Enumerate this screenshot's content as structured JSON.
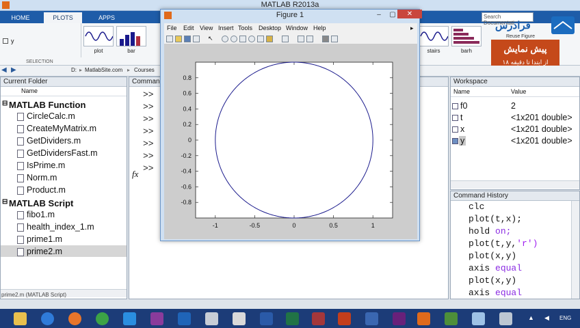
{
  "window": {
    "title": "MATLAB R2013a"
  },
  "ribbon": {
    "tabs": [
      "HOME",
      "PLOTS",
      "APPS"
    ],
    "variable_label": "y",
    "selection_label": "SELECTION",
    "gallery_left": [
      "plot",
      "bar"
    ],
    "gallery_right": [
      "stairs",
      "barh"
    ],
    "reuse_figure": "Reuse Figure",
    "search_placeholder": "Search Documentati"
  },
  "address": {
    "crumbs": [
      "D:",
      "MatlabSite.com",
      "Courses"
    ]
  },
  "current_folder": {
    "title": "Current Folder",
    "col_name": "Name",
    "sections": [
      {
        "name": "MATLAB Function",
        "files": [
          "CircleCalc.m",
          "CreateMyMatrix.m",
          "GetDividers.m",
          "GetDividersFast.m",
          "IsPrime.m",
          "Norm.m",
          "Product.m"
        ]
      },
      {
        "name": "MATLAB Script",
        "files": [
          "fibo1.m",
          "health_index_1.m",
          "prime1.m",
          "prime2.m"
        ]
      }
    ],
    "selected_file": "prime2.m",
    "status": "prime2.m (MATLAB Script)"
  },
  "command_window": {
    "title": "Comman",
    "prompts": [
      ">>",
      ">>",
      ">>",
      ">>",
      ">>",
      ">>",
      ">>"
    ],
    "fx": "fx"
  },
  "figure": {
    "title": "Figure 1",
    "menu": [
      "File",
      "Edit",
      "View",
      "Insert",
      "Tools",
      "Desktop",
      "Window",
      "Help"
    ],
    "more_arrow": "▸"
  },
  "chart_data": {
    "type": "line",
    "series": [
      {
        "values_desc": "unit circle",
        "color": "#1a1a8c"
      }
    ],
    "x": "x = cos(t)",
    "xticks": [
      "-1",
      "-0.5",
      "0",
      "0.5",
      "1"
    ],
    "yticks": [
      "0.8",
      "0.6",
      "0.4",
      "0.2",
      "0",
      "-0.2",
      "-0.4",
      "-0.6",
      "-0.8"
    ],
    "xlim": [
      -1.25,
      1.25
    ],
    "ylim": [
      -1,
      1
    ],
    "title": "",
    "xlabel": "",
    "ylabel": ""
  },
  "workspace": {
    "title": "Workspace",
    "col_name": "Name",
    "col_value": "Value",
    "rows": [
      {
        "name": "f0",
        "value": "2"
      },
      {
        "name": "t",
        "value": "<1x201 double>"
      },
      {
        "name": "x",
        "value": "<1x201 double>"
      },
      {
        "name": "y",
        "value": "<1x201 double>"
      }
    ]
  },
  "command_history": {
    "title": "Command History",
    "lines": [
      {
        "a": "clc",
        "b": ""
      },
      {
        "a": "plot(t,x);",
        "b": ""
      },
      {
        "a": "hold ",
        "b": "on;"
      },
      {
        "a": "plot(t,y,",
        "b": "'r')"
      },
      {
        "a": "plot(x,y)",
        "b": ""
      },
      {
        "a": "axis ",
        "b": "equal"
      },
      {
        "a": "plot(x,y)",
        "b": ""
      },
      {
        "a": "axis ",
        "b": "equal"
      }
    ]
  },
  "ad": {
    "line1": "پیش نمایش",
    "line2": "از ابتدا تا دقیقه ۱۸",
    "brand": "فرادرس"
  },
  "taskbar": {
    "lang": "ENG"
  }
}
